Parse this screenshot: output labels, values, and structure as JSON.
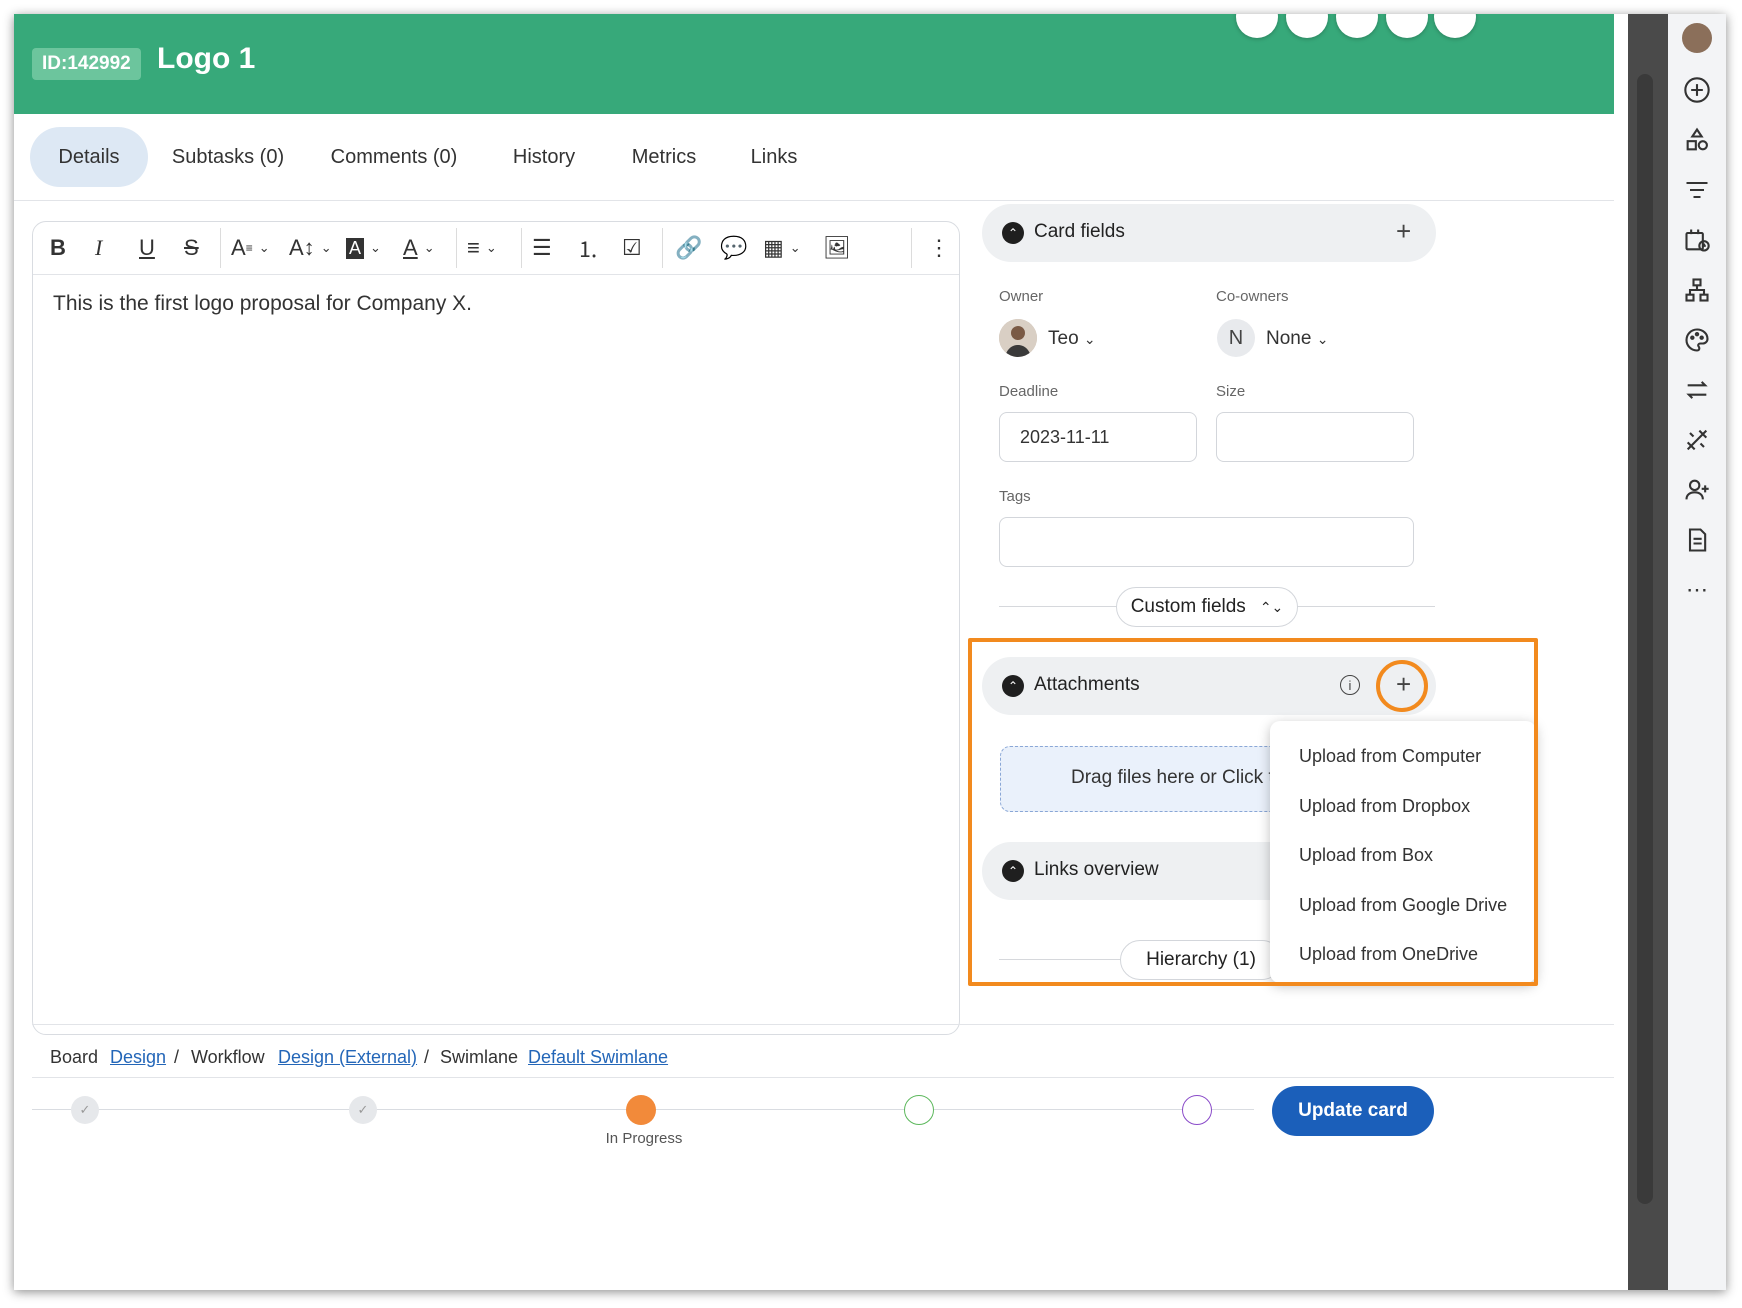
{
  "header": {
    "id_badge": "ID:142992",
    "title": "Logo 1"
  },
  "tabs": [
    "Details",
    "Subtasks (0)",
    "Comments (0)",
    "History",
    "Metrics",
    "Links"
  ],
  "editor": {
    "content": "This is the first logo proposal for Company X."
  },
  "card_fields": {
    "title": "Card fields",
    "owner_label": "Owner",
    "owner_value": "Teo",
    "coowners_label": "Co-owners",
    "coowners_avatar": "N",
    "coowners_value": "None",
    "deadline_label": "Deadline",
    "deadline_value": "2023-11-11",
    "size_label": "Size",
    "size_value": "",
    "tags_label": "Tags",
    "custom_fields_label": "Custom fields"
  },
  "attachments": {
    "title": "Attachments",
    "dropzone_text": "Drag files here or Click to upload",
    "menu": [
      "Upload from Computer",
      "Upload from Dropbox",
      "Upload from Box",
      "Upload from Google Drive",
      "Upload from OneDrive"
    ]
  },
  "links_overview": {
    "title": "Links overview",
    "hierarchy_label": "Hierarchy (1)"
  },
  "breadcrumb": {
    "board_label": "Board",
    "board_value": "Design",
    "workflow_label": "Workflow",
    "workflow_value": "Design (External)",
    "swimlane_label": "Swimlane",
    "swimlane_value": "Default Swimlane",
    "separator": "/"
  },
  "workflow_steps": {
    "current_label": "In Progress"
  },
  "footer": {
    "update_button": "Update card"
  },
  "colors": {
    "header": "#37a97a",
    "accent_orange": "#f28a1e",
    "primary_button": "#1b5fba"
  },
  "icons": [
    "plus-circle-icon",
    "shapes-icon",
    "filter-icon",
    "calendar-clock-icon",
    "hierarchy-icon",
    "palette-icon",
    "swap-icon",
    "tools-icon",
    "add-user-icon",
    "document-icon",
    "more-icon"
  ]
}
